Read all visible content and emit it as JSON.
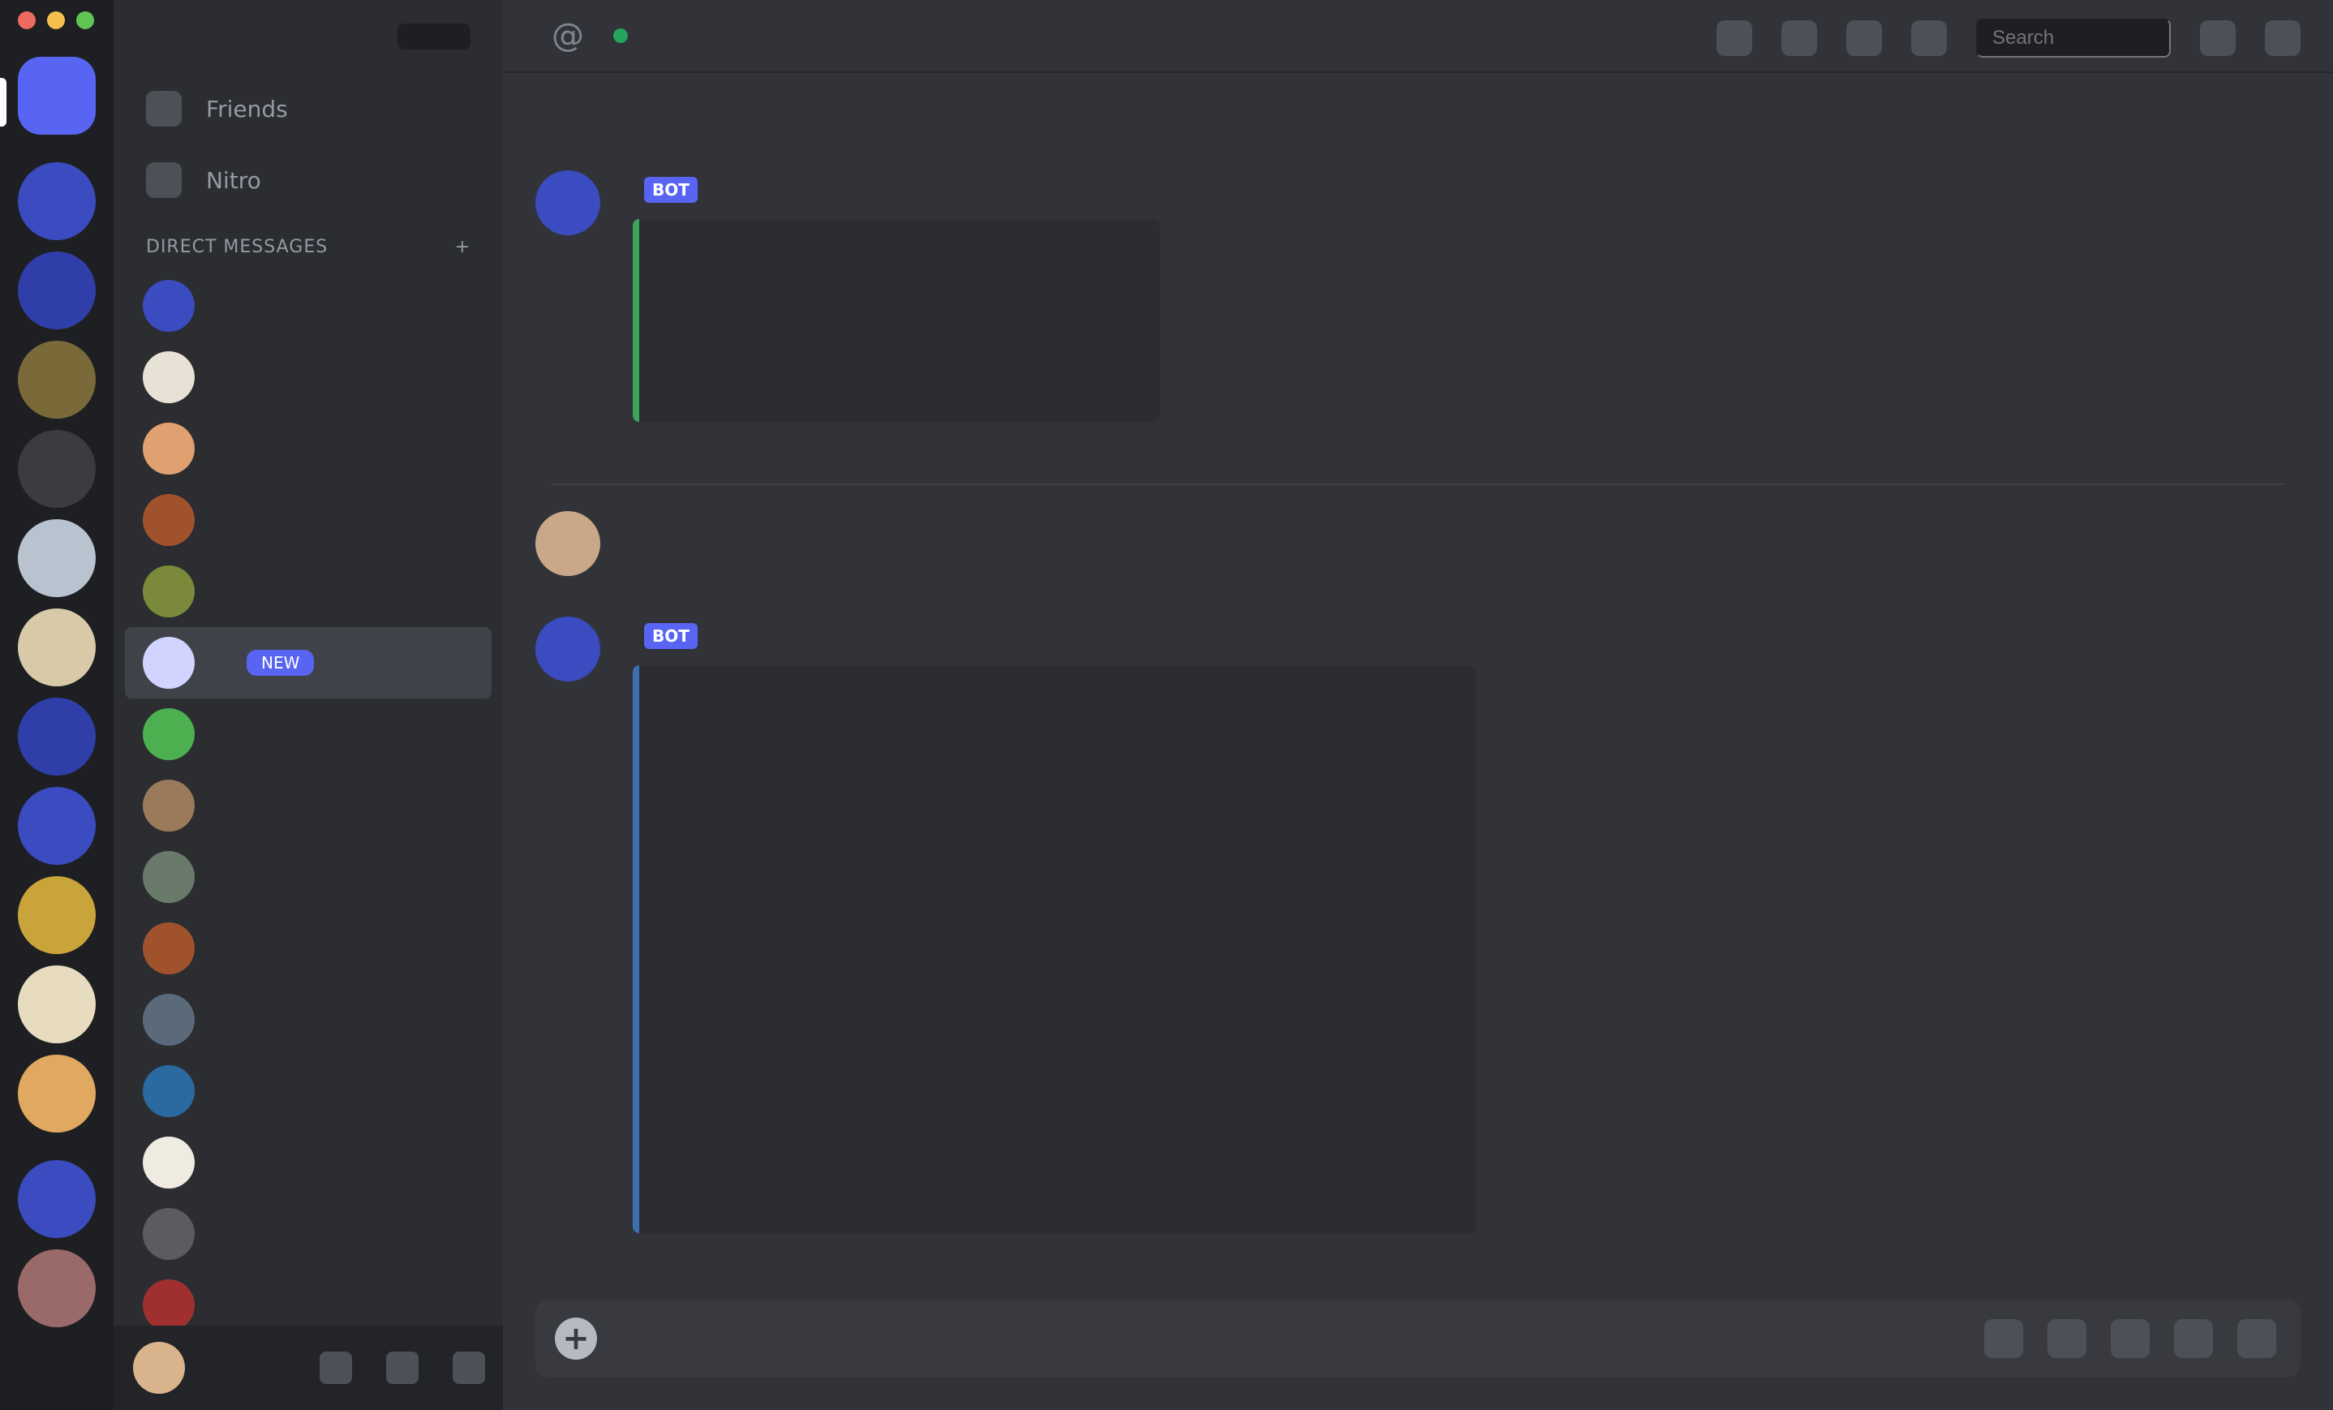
{
  "window": {
    "traffic_colors": [
      "#ed6a5e",
      "#f5bf4f",
      "#61c554"
    ]
  },
  "rail": {
    "servers": [
      {
        "label": "",
        "color": "#5865f2",
        "shape": "sq",
        "selected": true
      },
      {
        "label": "",
        "color": "#3b4bc0",
        "shape": "circle"
      },
      {
        "label": "",
        "color": "#2f3ea8",
        "shape": "circle"
      },
      {
        "label": "",
        "color": "#7a6a3a",
        "shape": "circle"
      },
      {
        "label": "",
        "color": "#3a3c42",
        "shape": "circle"
      },
      {
        "label": "",
        "color": "#b9c3cf",
        "shape": "circle"
      },
      {
        "label": "",
        "color": "#d8c9a8",
        "shape": "circle"
      },
      {
        "label": "",
        "color": "#2f3ea8",
        "shape": "circle"
      },
      {
        "label": "",
        "color": "#3b4bc0",
        "shape": "circle"
      },
      {
        "label": "",
        "color": "#c9a43a",
        "shape": "circle"
      },
      {
        "label": "",
        "color": "#e8dcc0",
        "shape": "circle"
      },
      {
        "label": "",
        "color": "#e0a860",
        "shape": "circle"
      },
      {
        "label": "",
        "color": "#3b4bc0",
        "shape": "circle"
      },
      {
        "label": "",
        "color": "#9a6a6a",
        "shape": "circle"
      }
    ]
  },
  "sidebar": {
    "nav": [
      {
        "label": "Friends"
      },
      {
        "label": "Nitro"
      }
    ],
    "dm_header": "DIRECT MESSAGES",
    "dm_add": "+",
    "dms": [
      {
        "name": "",
        "sub": "",
        "color": "#3b4bc0"
      },
      {
        "name": "",
        "sub": "",
        "color": "#e8e2d6"
      },
      {
        "name": "",
        "sub": "",
        "color": "#e0a070"
      },
      {
        "name": "",
        "sub": "",
        "color": "#a0522d"
      },
      {
        "name": "",
        "sub": "",
        "color": "#7a8a3a"
      },
      {
        "name": "",
        "sub": "",
        "color": "#d0d4ff",
        "badge": "NEW",
        "active": true
      },
      {
        "name": "",
        "sub": "",
        "color": "#4caf50"
      },
      {
        "name": "",
        "sub": "",
        "color": "#9a7a5a"
      },
      {
        "name": "",
        "sub": "",
        "color": "#6a7a6a"
      },
      {
        "name": "",
        "sub": "",
        "color": "#a0522d"
      },
      {
        "name": "",
        "sub": "",
        "color": "#5a6a7a"
      },
      {
        "name": "",
        "sub": "",
        "color": "#2a6aa0"
      },
      {
        "name": "",
        "sub": "",
        "color": "#f0ebe0"
      },
      {
        "name": "",
        "sub": "",
        "color": "#5a5c62"
      },
      {
        "name": "",
        "sub": "",
        "color": "#a03030"
      }
    ],
    "user": {
      "name": ""
    }
  },
  "topbar": {
    "at_symbol": "@",
    "name": "",
    "search_placeholder": "Search"
  },
  "messages": [
    {
      "author": "",
      "bot_tag": "BOT",
      "timestamp": "",
      "text": ""
    },
    {
      "author": "",
      "bot_tag": "",
      "timestamp": "",
      "text": ""
    },
    {
      "author": "",
      "bot_tag": "BOT",
      "timestamp": "",
      "text": ""
    }
  ],
  "divider": {
    "label": ""
  },
  "composer": {
    "placeholder": "",
    "plus": "+"
  }
}
